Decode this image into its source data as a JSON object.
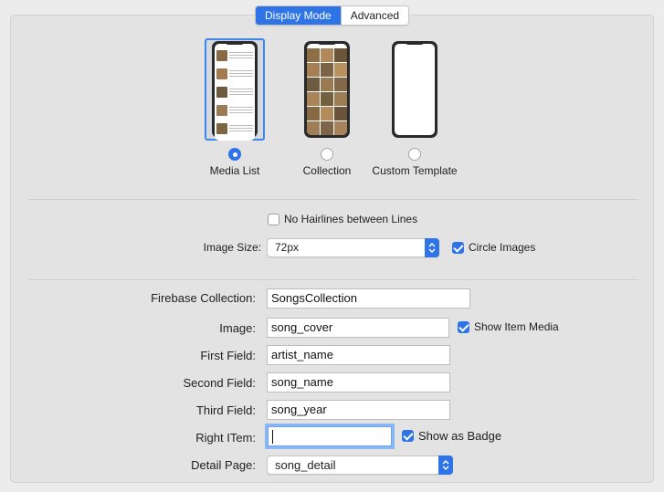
{
  "tabs": [
    {
      "label": "Display Mode",
      "active": true
    },
    {
      "label": "Advanced",
      "active": false
    }
  ],
  "display_modes": [
    {
      "label": "Media List",
      "selected": true
    },
    {
      "label": "Collection",
      "selected": false
    },
    {
      "label": "Custom Template",
      "selected": false
    }
  ],
  "options": {
    "no_hairlines_label": "No Hairlines between Lines",
    "no_hairlines_checked": false,
    "image_size_label": "Image Size:",
    "image_size_value": "72px",
    "circle_images_label": "Circle Images",
    "circle_images_checked": true
  },
  "form": {
    "firebase_collection_label": "Firebase Collection:",
    "firebase_collection_value": "SongsCollection",
    "image_label": "Image:",
    "image_value": "song_cover",
    "show_item_media_label": "Show Item Media",
    "show_item_media_checked": true,
    "first_field_label": "First Field:",
    "first_field_value": "artist_name",
    "second_field_label": "Second Field:",
    "second_field_value": "song_name",
    "third_field_label": "Third Field:",
    "third_field_value": "song_year",
    "right_item_label": "Right ITem:",
    "right_item_value": "",
    "show_as_badge_label": "Show as Badge",
    "show_as_badge_checked": true,
    "detail_page_label": "Detail Page:",
    "detail_page_value": "song_detail"
  },
  "colors": {
    "accent": "#2f74e6",
    "panel": "#e3e3e3",
    "window": "#ececec"
  }
}
